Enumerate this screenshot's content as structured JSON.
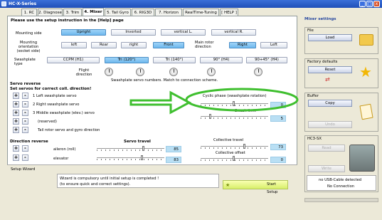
{
  "window": {
    "title": "HC-X-Series",
    "min": "_",
    "max": "□",
    "close": "x"
  },
  "tabs": [
    "1. RC",
    "2. Diagnose",
    "3. Trim",
    "4. Mixer",
    "5. Tail Gyro",
    "6. RIG3D",
    "7. Horizon",
    "RealTime-Tuning",
    "[ HELP ]"
  ],
  "hint": "Please use the setup instruction in the [Help] page",
  "mounting": {
    "label": "Mounting side",
    "options": [
      "Upright",
      "Inverted",
      "vertical L.",
      "vertical R."
    ]
  },
  "orientation": {
    "label": "Mounting orientation (socket side)",
    "options": [
      "left",
      "Rear",
      "right",
      "Front"
    ]
  },
  "rotor_dir": {
    "label": "Main rotor direction",
    "options": [
      "Right",
      "Left"
    ]
  },
  "swashplate": {
    "label": "Swashplate type",
    "options": [
      "CCPM (H1)",
      "Tri (120°)",
      "Tri (140°)",
      "90° (H4)",
      "90+45° (H4)"
    ]
  },
  "flight_direction": "Flight direction",
  "servo_hint": "Swashplate servo numbers. Match to connection scheme.",
  "servo_reverse": {
    "title": "Servo reverse",
    "subtitle": "Set servos for correct coll. direction!",
    "items": [
      "1  Left swashplate servo",
      "2  Right swashplate servo",
      "3  Middle swashplate (elev.) servo",
      "(reserved)",
      "Tail rotor servo and gyro direction"
    ]
  },
  "cyclic_phase": {
    "label": "Cyclic phase (swashplate rotation)",
    "value": "0"
  },
  "swash_limit": {
    "label": "Swash limit",
    "value": "5"
  },
  "direction_reverse": {
    "title": "Direction reverse",
    "aileron": "aileron (roll)",
    "elevator": "elevator"
  },
  "servo_travel": {
    "title": "Servo travel",
    "aileron_value": "85",
    "elevator_value": "83"
  },
  "collective_travel": {
    "label": "Collective travel",
    "value": "73"
  },
  "collective_offset": {
    "label": "Collective offset",
    "value": "0"
  },
  "wizard": {
    "title": "Setup Wizard",
    "line1": "Wizard is compulsory until initial setup is completed !",
    "line2": "(to ensure quick and correct settings).",
    "start": "Start Setup"
  },
  "sidebar": {
    "title": "Mixer settings",
    "file": "File",
    "load": "Load",
    "factory": "Factory defaults",
    "reset": "Reset",
    "buffer": "Buffer",
    "copy": "Copy",
    "undo": "Undo",
    "device": "HC3-SX",
    "read": "Read",
    "write": "Write",
    "usb": "no USB-Cable detected",
    "conn": "No Connection"
  },
  "colors": {
    "accent": "#6fb9ee",
    "value_bg": "#b9dff4",
    "annotation": "#3fbf2f"
  }
}
